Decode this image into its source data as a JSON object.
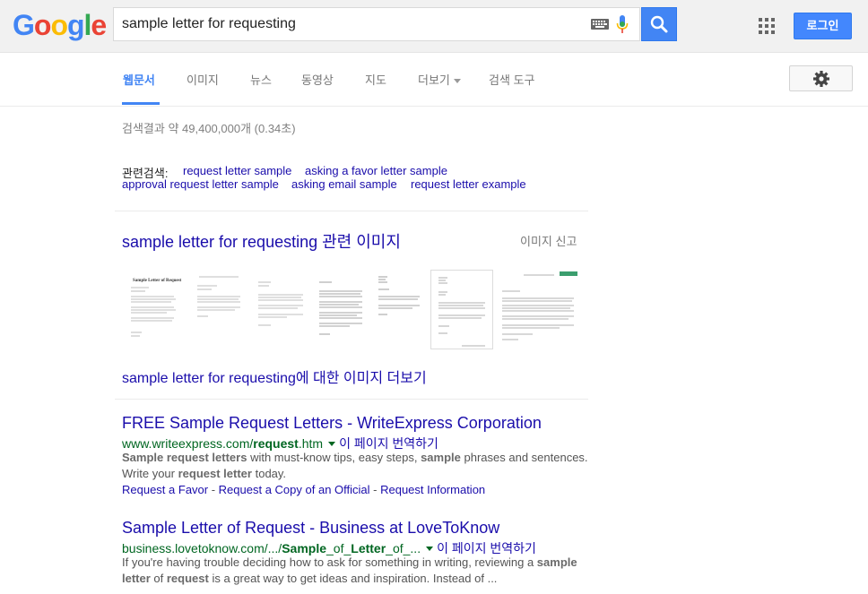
{
  "header": {
    "logo": [
      "G",
      "o",
      "o",
      "g",
      "l",
      "e"
    ],
    "logo_colors": [
      "#4285f4",
      "#ea4335",
      "#fbbc05",
      "#4285f4",
      "#34a853",
      "#ea4335"
    ],
    "query": "sample letter for requesting",
    "login_label": "로그인"
  },
  "tabs": [
    {
      "label": "웹문서",
      "active": true
    },
    {
      "label": "이미지"
    },
    {
      "label": "뉴스"
    },
    {
      "label": "동영상"
    },
    {
      "label": "지도"
    },
    {
      "label": "더보기"
    },
    {
      "label": "검색 도구"
    }
  ],
  "stats": "검색결과 약 49,400,000개 (0.34초)",
  "related": {
    "label": "관련검색:",
    "items": [
      "request letter sample",
      "asking a favor letter sample",
      "approval request letter sample",
      "asking email sample",
      "request letter example"
    ]
  },
  "images": {
    "heading": "sample letter for requesting 관련 이미지",
    "report": "이미지 신고",
    "more": "sample letter for requesting에 대한 이미지 더보기",
    "thumb_titles": [
      "Sample Letter of Request"
    ]
  },
  "results": [
    {
      "title": "FREE Sample Request Letters - WriteExpress Corporation",
      "url_pre": "www.writeexpress.com/",
      "url_bold": "request",
      "url_post": ".htm",
      "translate": "이 페이지 번역하기",
      "snippet_parts": [
        {
          "t": "Sample request letters",
          "b": true
        },
        {
          "t": " with must-know tips, easy steps, ",
          "b": false
        },
        {
          "t": "sample",
          "b": true
        },
        {
          "t": " phrases and sentences. Write your ",
          "b": false
        },
        {
          "t": "request letter",
          "b": true
        },
        {
          "t": " today.",
          "b": false
        }
      ],
      "sitelinks": [
        "Request a Favor",
        "Request a Copy of an Official",
        "Request Information"
      ]
    },
    {
      "title": "Sample Letter of Request - Business at LoveToKnow",
      "url_pre": "business.lovetoknow.com/.../",
      "url_bold": "Sample",
      "url_mid": "_of_",
      "url_bold2": "Letter",
      "url_post": "_of_...",
      "translate": "이 페이지 번역하기",
      "snippet_parts": [
        {
          "t": "If you're having trouble deciding how to ask for something in writing, reviewing a ",
          "b": false
        },
        {
          "t": "sample letter",
          "b": true
        },
        {
          "t": " of ",
          "b": false
        },
        {
          "t": "request",
          "b": true
        },
        {
          "t": " is a great way to get ideas and inspiration. Instead of ...",
          "b": false
        }
      ]
    }
  ]
}
